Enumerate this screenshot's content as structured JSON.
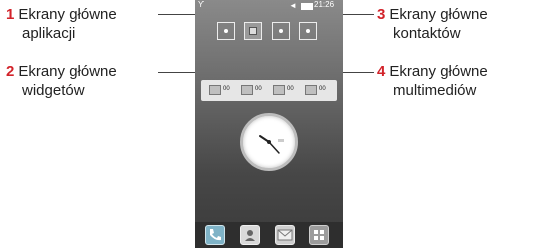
{
  "labels": [
    {
      "number": "1",
      "lines": [
        "Ekrany główne",
        "aplikacji"
      ]
    },
    {
      "number": "2",
      "lines": [
        "Ekrany główne",
        "widgetów"
      ]
    },
    {
      "number": "3",
      "lines": [
        "Ekrany główne",
        "kontaktów"
      ]
    },
    {
      "number": "4",
      "lines": [
        "Ekrany główne",
        "multimediów"
      ]
    }
  ],
  "phone": {
    "status_time": "21:26",
    "widget_counts": [
      "00",
      "00",
      "00",
      "00"
    ]
  },
  "colors": {
    "number_accent": "#d2232a"
  }
}
